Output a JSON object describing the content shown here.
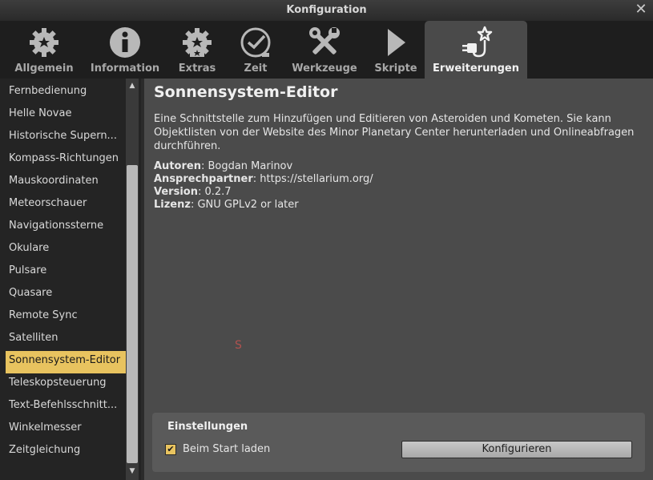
{
  "window": {
    "title": "Konfiguration",
    "close_glyph": "✕"
  },
  "tabs": [
    {
      "label": "Allgemein",
      "icon": "gear-icon"
    },
    {
      "label": "Information",
      "icon": "info-icon"
    },
    {
      "label": "Extras",
      "icon": "gear-star-icon"
    },
    {
      "label": "Zeit",
      "icon": "clock-icon"
    },
    {
      "label": "Werkzeuge",
      "icon": "tools-icon"
    },
    {
      "label": "Skripte",
      "icon": "play-icon"
    },
    {
      "label": "Erweiterungen",
      "icon": "plugin-icon",
      "active": true
    }
  ],
  "sidebar": {
    "items": [
      "Fernbedienung",
      "Helle Novae",
      "Historische Supern...",
      "Kompass-Richtungen",
      "Mauskoordinaten",
      "Meteorschauer",
      "Navigationssterne",
      "Okulare",
      "Pulsare",
      "Quasare",
      "Remote Sync",
      "Satelliten",
      "Sonnensystem-Editor",
      "Teleskopsteuerung",
      "Text-Befehlsschnitt...",
      "Winkelmesser",
      "Zeitgleichung"
    ],
    "selected_index": 12,
    "scroll_up": "▲",
    "scroll_down": "▼"
  },
  "plugin": {
    "title": "Sonnensystem-Editor",
    "description": "Eine Schnittstelle zum Hinzufügen und Editieren von Asteroiden und Kometen. Sie kann Objektlisten von der Website des Minor Planetary Center herunterladen und Onlineabfragen durchführen.",
    "authors_key": "Autoren",
    "authors": ": Bogdan Marinov",
    "contact_key": "Ansprechpartner",
    "contact": ": https://stellarium.org/",
    "version_key": "Version",
    "version": ": 0.2.7",
    "license_key": "Lizenz",
    "license": ": GNU GPLv2 or later",
    "sky_label": "S"
  },
  "settings": {
    "title": "Einstellungen",
    "load_at_startup_label": "Beim Start laden",
    "load_at_startup_checked": true,
    "check_glyph": "✔",
    "configure_button": "Konfigurieren"
  },
  "colors": {
    "accent": "#e8c35f",
    "background": "#4b4b4b",
    "sidebar_bg": "#242424",
    "tabbar_bg": "#1e1e1e"
  }
}
